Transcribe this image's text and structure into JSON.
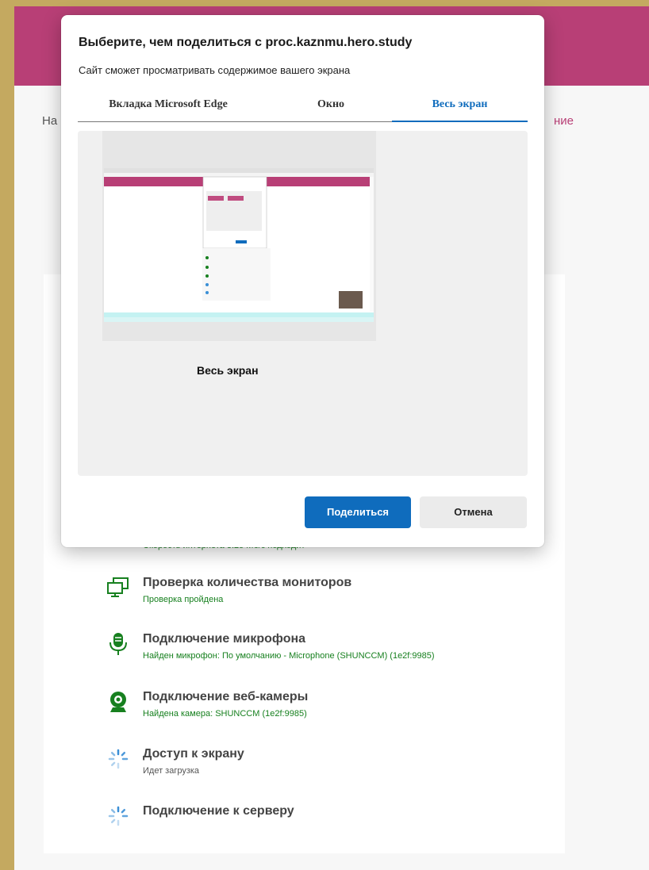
{
  "background_page": {
    "nav_left_fragment": "На",
    "nav_right_fragment": "ние",
    "speed_check_subtitle": "Скорость интернета 3.25 Мб/с подходит",
    "checks": [
      {
        "title": "Проверка количества мониторов",
        "status": "Проверка пройдена",
        "icon": "monitors-icon"
      },
      {
        "title": "Подключение микрофона",
        "status": "Найден микрофон: По умолчанию - Microphone (SHUNCCM) (1e2f:9985)",
        "icon": "microphone-icon"
      },
      {
        "title": "Подключение веб-камеры",
        "status": "Найдена камера: SHUNCCM (1e2f:9985)",
        "icon": "webcam-icon"
      },
      {
        "title": "Доступ к экрану",
        "status": "Идет загрузка",
        "icon": "loading-spinner-icon"
      },
      {
        "title": "Подключение к серверу",
        "status": "",
        "icon": "loading-spinner-icon"
      }
    ]
  },
  "dialog": {
    "title": "Выберите, чем поделиться с proc.kaznmu.hero.study",
    "subtitle": "Сайт сможет просматривать содержимое вашего экрана",
    "tabs": [
      {
        "label": "Вкладка Microsoft Edge",
        "active": false
      },
      {
        "label": "Окно",
        "active": false
      },
      {
        "label": "Весь экран",
        "active": true
      }
    ],
    "screen_label": "Весь экран",
    "share_button": "Поделиться",
    "cancel_button": "Отмена"
  },
  "colors": {
    "brand": "#b83f76",
    "accent": "#0f6cbd",
    "success": "#17801f",
    "frame": "#c4a960"
  }
}
